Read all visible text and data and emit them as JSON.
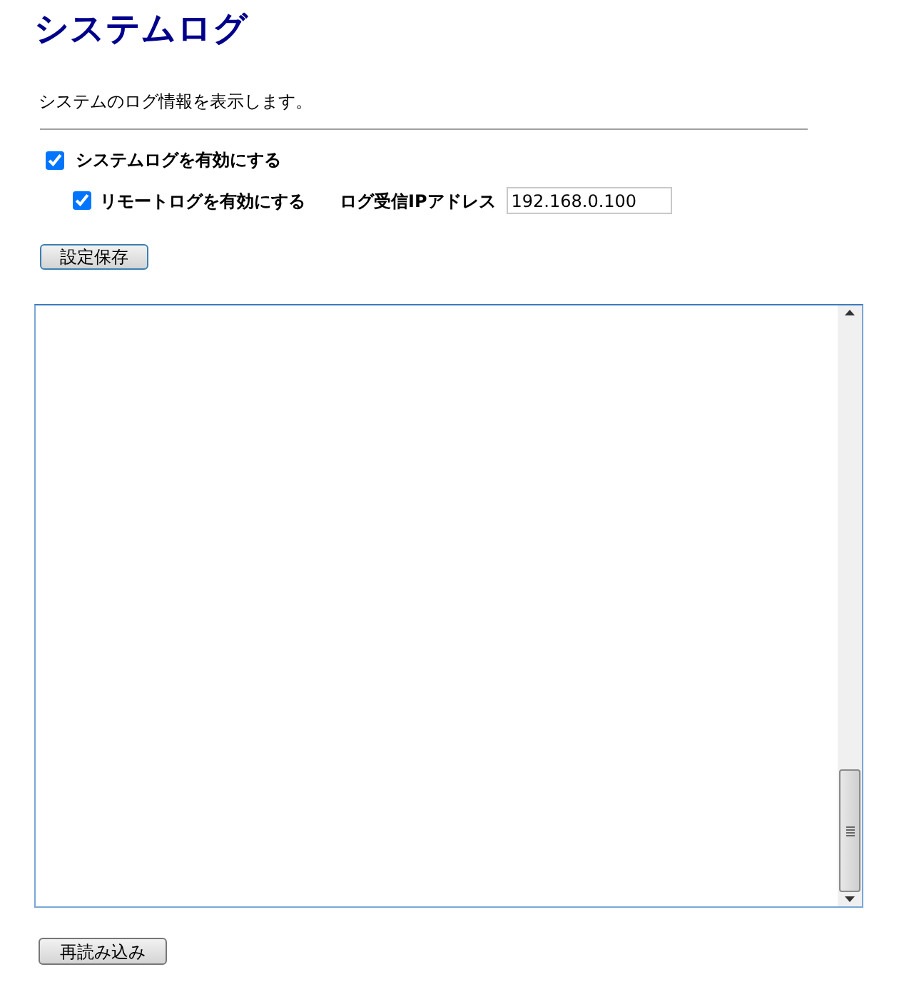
{
  "title": "システムログ",
  "description": "システムのログ情報を表示します。",
  "syslog_enable": {
    "label": "システムログを有効にする",
    "checked": true
  },
  "remote_log_enable": {
    "label": "リモートログを有効にする",
    "checked": true
  },
  "log_ip": {
    "label": "ログ受信IPアドレス",
    "value": "192.168.0.100"
  },
  "save_button": "設定保存",
  "reload_button": "再読み込み"
}
